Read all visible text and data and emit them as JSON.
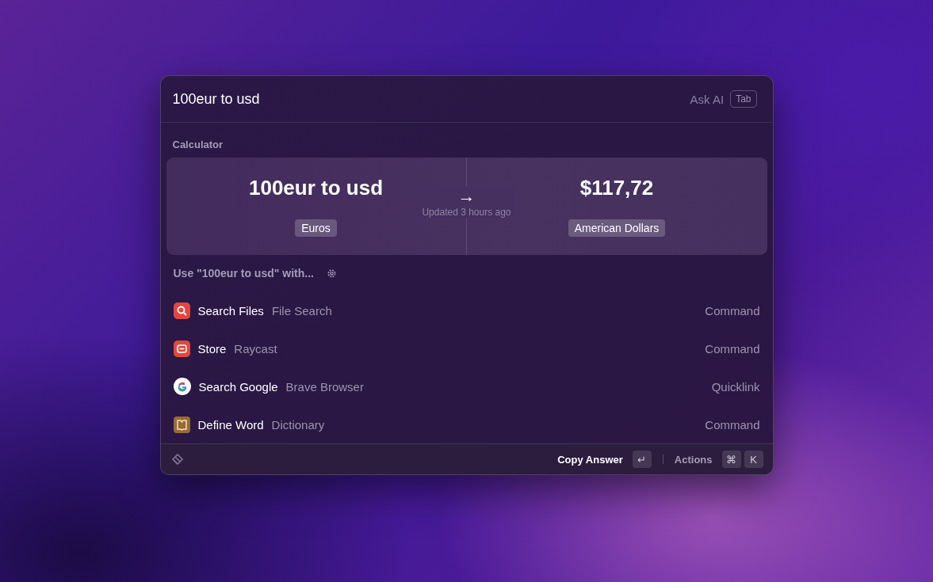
{
  "search": {
    "value": "100eur to usd",
    "ask_ai": "Ask AI",
    "ask_ai_key": "Tab"
  },
  "calculator": {
    "section": "Calculator",
    "input": "100eur to usd",
    "arrow": "→",
    "result": "$117,72",
    "updated": "Updated 3 hours ago",
    "from_unit": "Euros",
    "to_unit": "American Dollars"
  },
  "fallback": {
    "title": "Use \"100eur to usd\" with..."
  },
  "items": [
    {
      "kind": "file-search",
      "title": "Search Files",
      "subtitle": "File Search",
      "type": "Command"
    },
    {
      "kind": "store",
      "title": "Store",
      "subtitle": "Raycast",
      "type": "Command"
    },
    {
      "kind": "google",
      "title": "Search Google",
      "subtitle": "Brave Browser",
      "type": "Quicklink"
    },
    {
      "kind": "dictionary",
      "title": "Define Word",
      "subtitle": "Dictionary",
      "type": "Command"
    }
  ],
  "footer": {
    "primary": "Copy Answer",
    "primary_key": "↵",
    "actions": "Actions",
    "action_keys": [
      "⌘",
      "K"
    ]
  }
}
